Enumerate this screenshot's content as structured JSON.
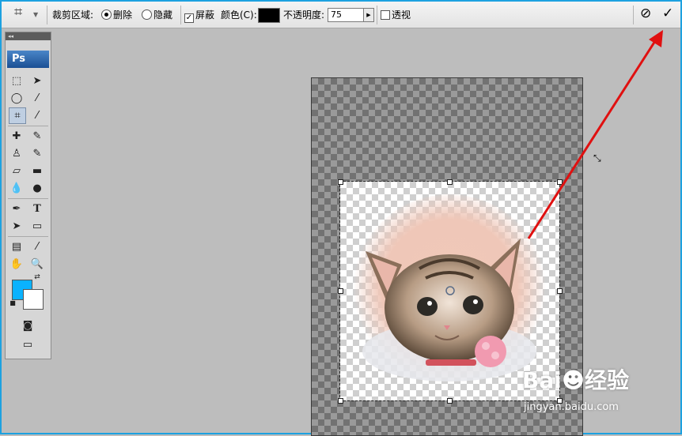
{
  "options_bar": {
    "crop_area_label": "裁剪区域:",
    "delete_label": "删除",
    "hide_label": "隐藏",
    "shield_label": "屏蔽",
    "color_label": "颜色(C):",
    "opacity_label": "不透明度:",
    "opacity_value": "75",
    "perspective_label": "透视",
    "delete_selected": true,
    "shield_checked": true,
    "perspective_checked": false
  },
  "toolbox": {
    "header": "◂◂",
    "ps_label": "Ps",
    "type_tool_glyph": "T"
  },
  "colors": {
    "foreground": "#0ab2ff",
    "background": "#ffffff",
    "annotation_arrow": "#e01010"
  },
  "watermark": {
    "brand": "Bai☻经验",
    "url": "jingyan.baidu.com"
  },
  "icons": [
    "crop-tool-icon",
    "cancel-icon",
    "commit-checkmark-icon"
  ]
}
